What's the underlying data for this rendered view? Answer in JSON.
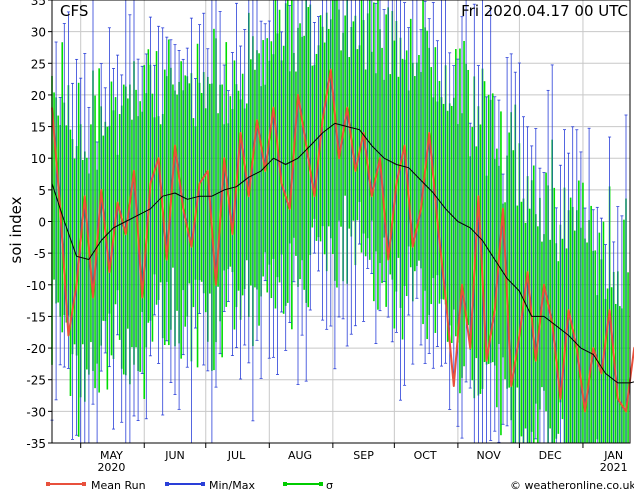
{
  "chart_data": {
    "type": "line",
    "model_label": "CFS",
    "date_label": "Fri 2020.04.17  00 UTC",
    "ylabel": "soi index",
    "xlabel": "",
    "ylim": [
      -35,
      35
    ],
    "yticks": [
      -35,
      -30,
      -25,
      -20,
      -15,
      -10,
      -5,
      0,
      5,
      10,
      15,
      20,
      25,
      30,
      35
    ],
    "grid": true,
    "x_months": [
      {
        "label": "MAY",
        "year": "2020"
      },
      {
        "label": "JUN",
        "year": ""
      },
      {
        "label": "JUL",
        "year": ""
      },
      {
        "label": "AUG",
        "year": ""
      },
      {
        "label": "SEP",
        "year": ""
      },
      {
        "label": "OCT",
        "year": ""
      },
      {
        "label": "NOV",
        "year": ""
      },
      {
        "label": "DEC",
        "year": ""
      },
      {
        "label": "JAN",
        "year": "2021"
      }
    ],
    "legend": [
      {
        "label": "Mean Run",
        "color": "#e8503c"
      },
      {
        "label": "Min/Max",
        "color": "#2a3fd8"
      },
      {
        "label": "σ",
        "color": "#00cc00"
      }
    ],
    "credit": "© weatheronline.co.uk",
    "colors": {
      "sigma": "#00dd00",
      "minmax": "#2a3fd8",
      "mean_run": "#e8503c",
      "ensemble_mean": "#000000",
      "grid": "#c8c8c8"
    },
    "series": [
      {
        "name": "ensemble mean",
        "x_days": [
          0,
          6,
          12,
          18,
          24,
          30,
          36,
          42,
          48,
          54,
          60,
          66,
          72,
          78,
          84,
          90,
          96,
          102,
          108,
          114,
          120,
          126,
          132,
          138,
          144,
          150,
          156,
          162,
          168,
          174,
          180,
          186,
          192,
          198,
          204,
          210,
          216,
          222,
          228,
          234,
          240,
          246,
          252,
          258,
          264,
          270,
          276,
          282,
          288,
          290
        ],
        "values": [
          6,
          0,
          -5.5,
          -6,
          -3,
          -1,
          0,
          1,
          2,
          4,
          4.5,
          3.5,
          4,
          4,
          5,
          5.5,
          7,
          8,
          10,
          9,
          10,
          12,
          14,
          15.5,
          15,
          14.5,
          12,
          10,
          9,
          8.5,
          6.5,
          4.5,
          2,
          0,
          -1,
          -3,
          -6,
          -9,
          -11,
          -15,
          -15,
          -16.5,
          -18,
          -20,
          -21,
          -24,
          -25.5,
          -25.5,
          -25,
          -26
        ]
      },
      {
        "name": "mean run",
        "x_days": [
          0,
          4,
          8,
          12,
          16,
          20,
          24,
          28,
          32,
          36,
          40,
          44,
          48,
          52,
          56,
          60,
          64,
          68,
          72,
          76,
          80,
          84,
          88,
          92,
          96,
          100,
          104,
          108,
          112,
          116,
          120,
          124,
          128,
          132,
          136,
          140,
          144,
          148,
          152,
          156,
          160,
          164,
          168,
          172,
          176,
          180,
          184,
          188,
          192,
          196,
          200,
          204,
          208,
          212,
          216,
          220,
          224,
          228,
          232,
          236,
          240,
          244,
          248,
          252,
          256,
          260,
          264,
          268,
          272,
          276,
          280,
          284,
          288,
          292
        ],
        "values": [
          18,
          2,
          -18,
          -10,
          4,
          -12,
          5,
          -8,
          3,
          -2,
          8,
          -12,
          6,
          10,
          -6,
          12,
          2,
          -4,
          6,
          8,
          -10,
          10,
          -2,
          14,
          4,
          16,
          8,
          18,
          6,
          2,
          20,
          12,
          4,
          16,
          24,
          10,
          18,
          8,
          14,
          4,
          10,
          -6,
          6,
          12,
          -4,
          2,
          14,
          0,
          -12,
          -26,
          -10,
          -20,
          4,
          -22,
          -14,
          2,
          -26,
          -18,
          -8,
          -22,
          -10,
          -16,
          -28,
          -14,
          -20,
          -30,
          -20,
          -24,
          -14,
          -28,
          -30,
          -20,
          -18,
          -22
        ]
      }
    ]
  }
}
